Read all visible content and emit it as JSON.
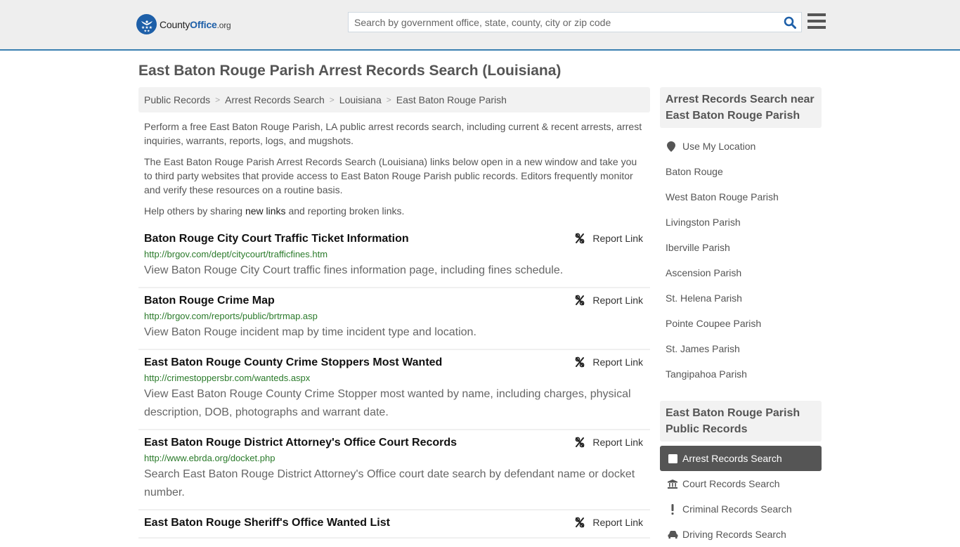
{
  "header": {
    "logo": {
      "name_main": "County",
      "name_accent": "Office",
      "name_suffix": ".org"
    },
    "search": {
      "placeholder": "Search by government office, state, county, city or zip code",
      "value": ""
    }
  },
  "page": {
    "title": "East Baton Rouge Parish Arrest Records Search (Louisiana)"
  },
  "breadcrumb": [
    {
      "label": "Public Records"
    },
    {
      "label": "Arrest Records Search"
    },
    {
      "label": "Louisiana"
    },
    {
      "label": "East Baton Rouge Parish"
    }
  ],
  "intro": {
    "p1": "Perform a free East Baton Rouge Parish, LA public arrest records search, including current & recent arrests, arrest inquiries, warrants, reports, logs, and mugshots.",
    "p2": "The East Baton Rouge Parish Arrest Records Search (Louisiana) links below open in a new window and take you to third party websites that provide access to East Baton Rouge Parish public records. Editors frequently monitor and verify these resources on a routine basis.",
    "p3_before": "Help others by sharing ",
    "p3_link": "new links",
    "p3_after": " and reporting broken links."
  },
  "report_label": "Report Link",
  "results": [
    {
      "title": "Baton Rouge City Court Traffic Ticket Information",
      "url": "http://brgov.com/dept/citycourt/trafficfines.htm",
      "desc": "View Baton Rouge City Court traffic fines information page, including fines schedule."
    },
    {
      "title": "Baton Rouge Crime Map",
      "url": "http://brgov.com/reports/public/brtrmap.asp",
      "desc": "View Baton Rouge incident map by time incident type and location."
    },
    {
      "title": "East Baton Rouge County Crime Stoppers Most Wanted",
      "url": "http://crimestoppersbr.com/wanteds.aspx",
      "desc": "View East Baton Rouge County Crime Stopper most wanted by name, including charges, physical description, DOB, photographs and warrant date."
    },
    {
      "title": "East Baton Rouge District Attorney's Office Court Records",
      "url": "http://www.ebrda.org/docket.php",
      "desc": "Search East Baton Rouge District Attorney's Office court date search by defendant name or docket number."
    },
    {
      "title": "East Baton Rouge Sheriff's Office Wanted List",
      "url": "",
      "desc": ""
    }
  ],
  "sidebar": {
    "nearby_heading": "Arrest Records Search near East Baton Rouge Parish",
    "use_location": "Use My Location",
    "nearby": [
      "Baton Rouge",
      "West Baton Rouge Parish",
      "Livingston Parish",
      "Iberville Parish",
      "Ascension Parish",
      "St. Helena Parish",
      "Pointe Coupee Parish",
      "St. James Parish",
      "Tangipahoa Parish"
    ],
    "public_heading": "East Baton Rouge Parish Public Records",
    "public_records": [
      {
        "label": "Arrest Records Search",
        "icon": "square-icon",
        "active": true
      },
      {
        "label": "Court Records Search",
        "icon": "courthouse-icon",
        "active": false
      },
      {
        "label": "Criminal Records Search",
        "icon": "exclamation-icon",
        "active": false
      },
      {
        "label": "Driving Records Search",
        "icon": "car-icon",
        "active": false
      }
    ]
  },
  "colors": {
    "header_bg": "#eeeeee",
    "header_border": "#3a7fb1",
    "brand_blue": "#1d5fa8",
    "url_green": "#2a7a2a",
    "active_bg": "#555555"
  }
}
